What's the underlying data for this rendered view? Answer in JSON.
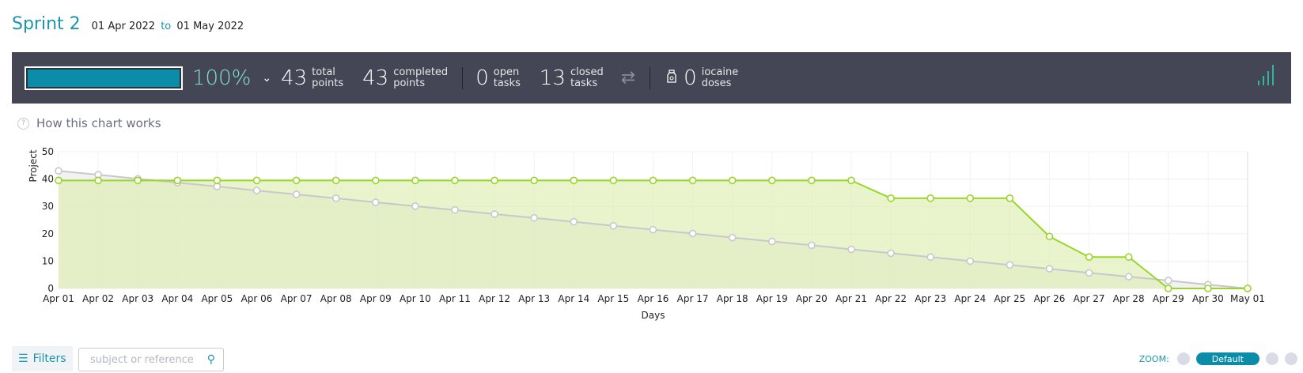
{
  "header": {
    "sprint_name": "Sprint 2",
    "start_date": "01 Apr 2022",
    "to_text": "to",
    "end_date": "01 May 2022"
  },
  "summary": {
    "progress_fraction": 1.0,
    "percent": "100%",
    "total_points": "43",
    "total_label_1": "total",
    "total_label_2": "points",
    "completed_points": "43",
    "completed_label_1": "completed",
    "completed_label_2": "points",
    "open_tasks": "0",
    "open_label_1": "open",
    "open_label_2": "tasks",
    "closed_tasks": "13",
    "closed_label_1": "closed",
    "closed_label_2": "tasks",
    "iocaine": "0",
    "iocaine_label_1": "iocaine",
    "iocaine_label_2": "doses",
    "colors": {
      "bar_bg": "#444655",
      "progress_fill": "#0b8ca8",
      "percent": "#7ee3d6",
      "signal": "#2fb6a0"
    },
    "icons": [
      "chevron-down-icon",
      "swap-arrows-icon",
      "potion-icon",
      "signal-bars-icon"
    ]
  },
  "help": {
    "label": "How this chart works",
    "icon": "question-icon"
  },
  "chart_data": {
    "type": "line",
    "xlabel": "Days",
    "ylabel": "Project",
    "ylim": [
      0,
      50
    ],
    "yticks": [
      0,
      10,
      20,
      30,
      40,
      50
    ],
    "categories": [
      "Apr 01",
      "Apr 02",
      "Apr 03",
      "Apr 04",
      "Apr 05",
      "Apr 06",
      "Apr 07",
      "Apr 08",
      "Apr 09",
      "Apr 10",
      "Apr 11",
      "Apr 12",
      "Apr 13",
      "Apr 14",
      "Apr 15",
      "Apr 16",
      "Apr 17",
      "Apr 18",
      "Apr 19",
      "Apr 20",
      "Apr 21",
      "Apr 22",
      "Apr 23",
      "Apr 24",
      "Apr 25",
      "Apr 26",
      "Apr 27",
      "Apr 28",
      "Apr 29",
      "Apr 30",
      "May 01"
    ],
    "series": [
      {
        "values": [
          43,
          41.6,
          40.1,
          38.7,
          37.3,
          35.8,
          34.4,
          33,
          31.5,
          30.1,
          28.7,
          27.2,
          25.8,
          24.4,
          22.9,
          21.5,
          20.1,
          18.6,
          17.2,
          15.8,
          14.3,
          12.9,
          11.5,
          10,
          8.6,
          7.2,
          5.7,
          4.3,
          2.9,
          1.4,
          0
        ],
        "color": "#c8c8cc",
        "fill": "#ececee"
      },
      {
        "values": [
          39.5,
          39.5,
          39.5,
          39.5,
          39.5,
          39.5,
          39.5,
          39.5,
          39.5,
          39.5,
          39.5,
          39.5,
          39.5,
          39.5,
          39.5,
          39.5,
          39.5,
          39.5,
          39.5,
          39.5,
          39.5,
          33,
          33,
          33,
          33,
          19,
          11.5,
          11.5,
          0,
          0,
          0
        ],
        "color": "#9ad62a",
        "fill": "#dcedaa"
      }
    ],
    "grid": true
  },
  "toolbar": {
    "filters_label": "Filters",
    "search_placeholder": "subject or reference",
    "zoom_label": "ZOOM:",
    "zoom_default": "Default"
  }
}
